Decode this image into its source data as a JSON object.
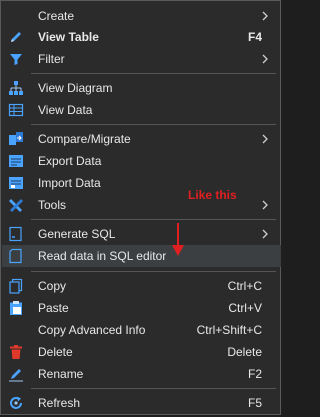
{
  "menu": {
    "items": [
      {
        "label": "Create",
        "shortcut": "",
        "submenu": true,
        "bold": false,
        "icon": "none"
      },
      {
        "label": "View Table",
        "shortcut": "F4",
        "submenu": false,
        "bold": true,
        "icon": "pencil-icon"
      },
      {
        "label": "Filter",
        "shortcut": "",
        "submenu": true,
        "bold": false,
        "icon": "filter-icon"
      },
      {
        "label": "View Diagram",
        "shortcut": "",
        "submenu": false,
        "bold": false,
        "icon": "diagram-icon"
      },
      {
        "label": "View Data",
        "shortcut": "",
        "submenu": false,
        "bold": false,
        "icon": "data-grid-icon"
      },
      {
        "label": "Compare/Migrate",
        "shortcut": "",
        "submenu": true,
        "bold": false,
        "icon": "compare-icon"
      },
      {
        "label": "Export Data",
        "shortcut": "",
        "submenu": false,
        "bold": false,
        "icon": "export-icon"
      },
      {
        "label": "Import Data",
        "shortcut": "",
        "submenu": false,
        "bold": false,
        "icon": "import-icon"
      },
      {
        "label": "Tools",
        "shortcut": "",
        "submenu": true,
        "bold": false,
        "icon": "tools-icon"
      },
      {
        "label": "Generate SQL",
        "shortcut": "",
        "submenu": true,
        "bold": false,
        "icon": "sql-icon"
      },
      {
        "label": "Read data in SQL editor",
        "shortcut": "",
        "submenu": false,
        "bold": false,
        "icon": "sql-editor-icon"
      },
      {
        "label": "Copy",
        "shortcut": "Ctrl+C",
        "submenu": false,
        "bold": false,
        "icon": "copy-icon"
      },
      {
        "label": "Paste",
        "shortcut": "Ctrl+V",
        "submenu": false,
        "bold": false,
        "icon": "paste-icon"
      },
      {
        "label": "Copy Advanced Info",
        "shortcut": "Ctrl+Shift+C",
        "submenu": false,
        "bold": false,
        "icon": "none"
      },
      {
        "label": "Delete",
        "shortcut": "Delete",
        "submenu": false,
        "bold": false,
        "icon": "trash-icon"
      },
      {
        "label": "Rename",
        "shortcut": "F2",
        "submenu": false,
        "bold": false,
        "icon": "rename-icon"
      },
      {
        "label": "Refresh",
        "shortcut": "F5",
        "submenu": false,
        "bold": false,
        "icon": "refresh-icon"
      }
    ],
    "highlighted_item": "Read data in SQL editor"
  },
  "annotation": {
    "text": "Like this",
    "color": "#e02020"
  },
  "colors": {
    "menu_bg": "#2b2b2b",
    "text": "#e8e8e8",
    "highlight": "#3c3f41",
    "separator": "#555555"
  }
}
